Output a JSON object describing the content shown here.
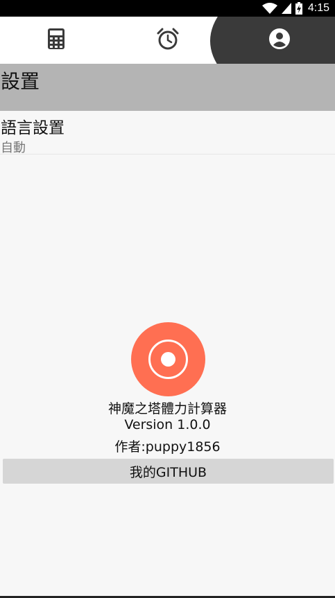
{
  "status_bar": {
    "time": "4:15",
    "icons": [
      "wifi-icon",
      "signal-icon",
      "battery-icon"
    ]
  },
  "tabs": [
    {
      "icon": "calculator-icon",
      "selected": false
    },
    {
      "icon": "alarm-clock-icon",
      "selected": false
    },
    {
      "icon": "account-circle-icon",
      "selected": true
    }
  ],
  "settings": {
    "title": "設置",
    "language": {
      "label": "語言設置",
      "value": "自動"
    }
  },
  "about": {
    "logo_icon": "app-logo-icon",
    "app_name": "神魔之塔體力計算器",
    "version": "Version 1.0.0",
    "author": "作者:puppy1856",
    "github_button": "我的GITHUB"
  },
  "colors": {
    "accent": "#ff6f52",
    "tab_selected_bg": "#3a3a3a",
    "header_bg": "#b4b4b4",
    "button_bg": "#d6d6d6"
  }
}
